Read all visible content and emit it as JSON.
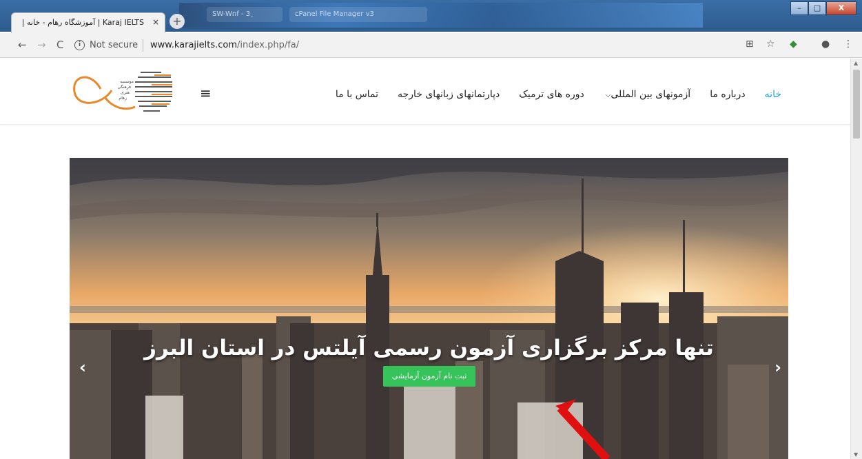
{
  "browser": {
    "tab_title": "Karaj IELTS | آموزشگاه رهام - خانه | ...ج",
    "tab_close": "×",
    "new_tab": "+",
    "nav_back": "←",
    "nav_forward": "→",
    "nav_reload": "C",
    "security_label": "Not secure",
    "url_host": "www.karajielts.com",
    "url_path": "/index.php/fa/",
    "window_minimize": "–",
    "window_maximize": "□",
    "window_close": "X",
    "bg_tabs": [
      "SW-Wnf - 3ِ",
      "cPanel File Manager v3"
    ]
  },
  "site": {
    "nav": [
      {
        "label": "خانه",
        "active": true
      },
      {
        "label": "درباره ما",
        "active": false
      },
      {
        "label": "آزمونهای بین المللی",
        "active": false,
        "has_dropdown": true
      },
      {
        "label": "دوره های ترمیک",
        "active": false
      },
      {
        "label": "دپارتمانهای زبانهای خارجه",
        "active": false
      },
      {
        "label": "تماس با ما",
        "active": false
      }
    ],
    "menu_icon": "hamburger-icon",
    "logo_text": [
      "موسسه",
      "فرهنگی",
      "هنری",
      "رهام"
    ],
    "hero": {
      "title": "تنها مرکز برگزاری آزمون رسمی آیلتس در استان البرز",
      "cta_label": "ثبت نام آزمون آزمایشی",
      "prev_arrow": "‹",
      "next_arrow": "›"
    }
  },
  "colors": {
    "nav_active": "#1ea0d8",
    "cta": "#35c35a",
    "logo_orange": "#e8892b",
    "annotation_arrow": "#e01010"
  }
}
